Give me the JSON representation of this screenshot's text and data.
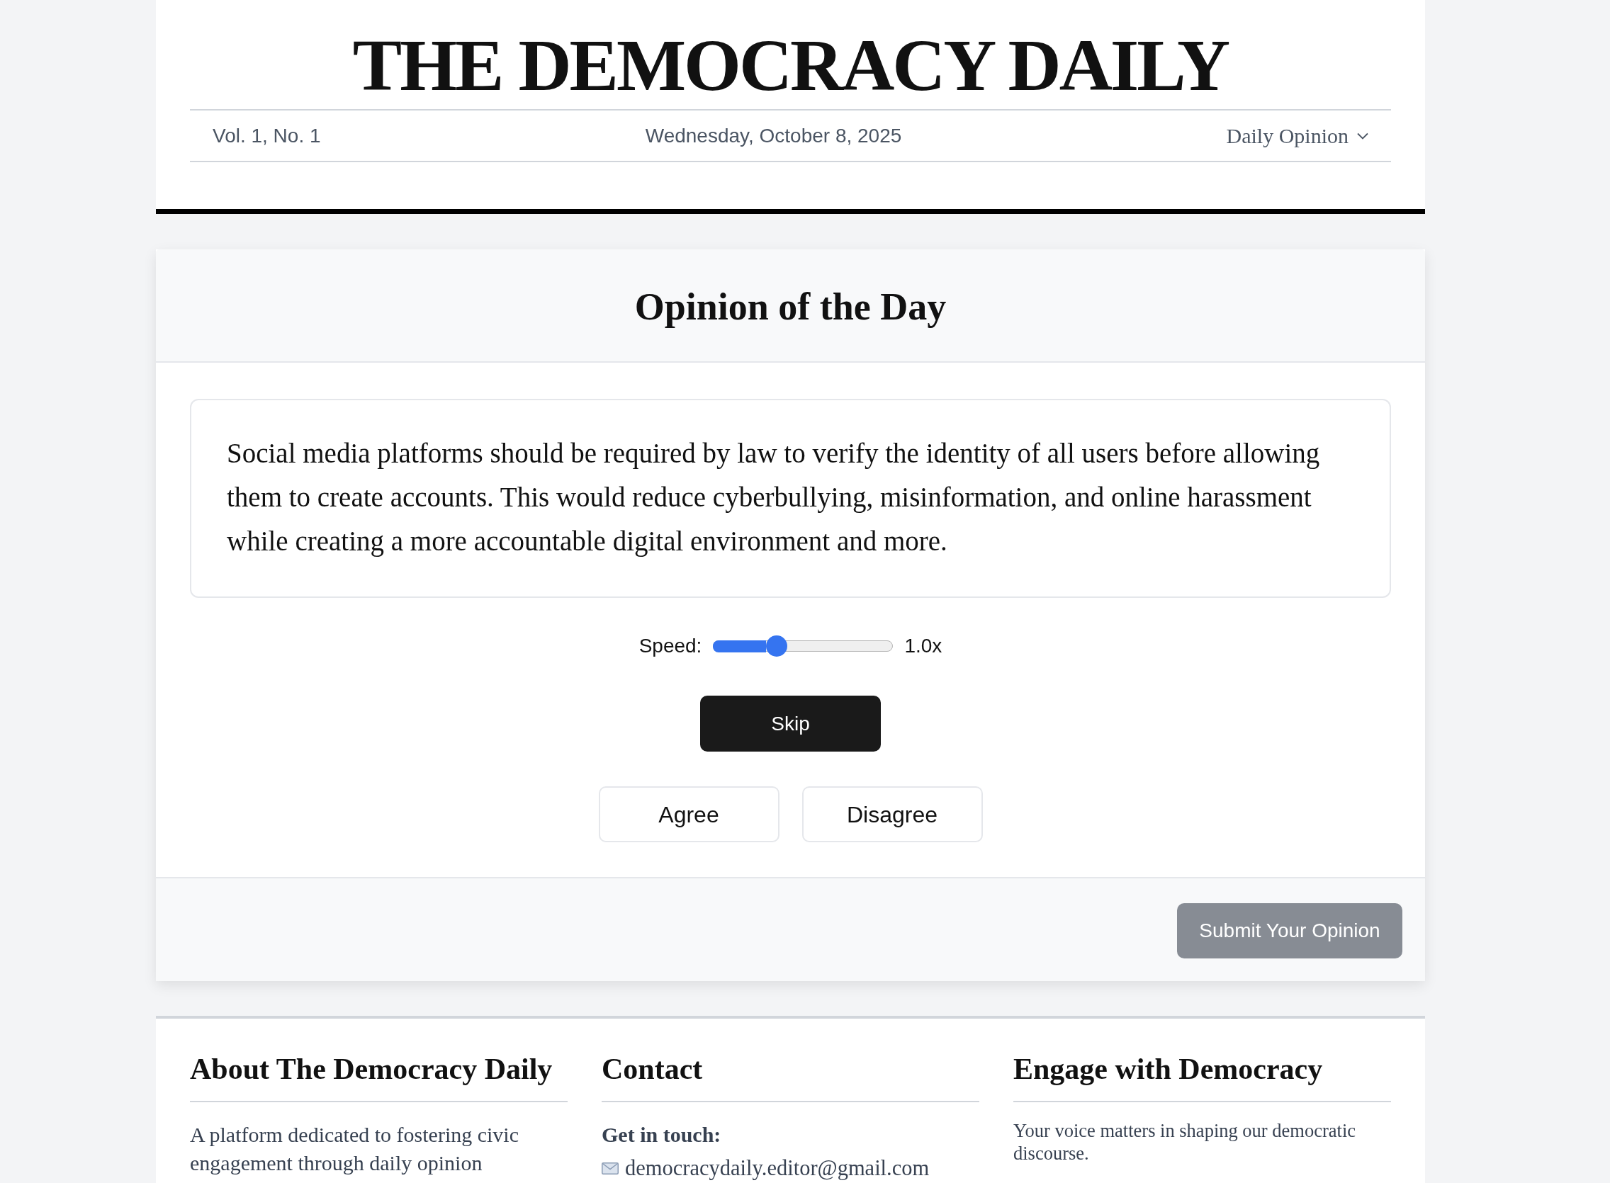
{
  "masthead": {
    "title": "THE DEMOCRACY DAILY",
    "volume": "Vol. 1, No. 1",
    "date": "Wednesday, October 8, 2025",
    "section_menu": {
      "label": "Daily Opinion"
    }
  },
  "opinion_card": {
    "title": "Opinion of the Day",
    "statement": "Social media platforms should be required by law to verify the identity of all users before allowing them to create accounts. This would reduce cyberbullying, misinformation, and online harassment while creating a more accountable digital environment and more.",
    "speed": {
      "label": "Speed:",
      "level": 0.33,
      "reading": "1.0x"
    },
    "skip_button": "Skip",
    "vote_buttons": [
      {
        "label": "Agree",
        "selected": false
      },
      {
        "label": "Disagree",
        "selected": false
      }
    ],
    "submit_button": {
      "label": "Submit Your Opinion",
      "disabled": true
    }
  },
  "footer": {
    "columns": [
      {
        "kind": "paragraph",
        "heading": "About The Democracy Daily",
        "text": "A platform dedicated to fostering civic engagement through daily opinion"
      },
      {
        "kind": "contact",
        "heading": "Contact",
        "subheading": "Get in touch:",
        "email": "democracydaily.editor@gmail.com"
      },
      {
        "kind": "note",
        "heading": "Engage with Democracy",
        "text": "Your voice matters in shaping our democratic discourse."
      }
    ]
  }
}
